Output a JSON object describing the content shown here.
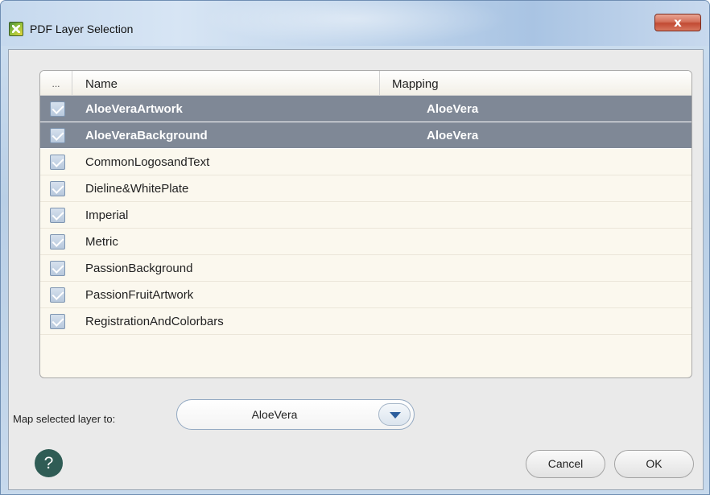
{
  "window": {
    "title": "PDF Layer Selection",
    "close_label": "x",
    "icon": "pdf-layer-app-icon"
  },
  "table": {
    "headers": {
      "select": "...",
      "name": "Name",
      "mapping": "Mapping"
    },
    "rows": [
      {
        "name": "AloeVeraArtwork",
        "mapping": "AloeVera",
        "checked": true,
        "selected": true
      },
      {
        "name": "AloeVeraBackground",
        "mapping": "AloeVera",
        "checked": true,
        "selected": true
      },
      {
        "name": "CommonLogosandText",
        "mapping": "",
        "checked": true,
        "selected": false
      },
      {
        "name": "Dieline&WhitePlate",
        "mapping": "",
        "checked": true,
        "selected": false
      },
      {
        "name": "Imperial",
        "mapping": "",
        "checked": true,
        "selected": false
      },
      {
        "name": "Metric",
        "mapping": "",
        "checked": true,
        "selected": false
      },
      {
        "name": "PassionBackground",
        "mapping": "",
        "checked": true,
        "selected": false
      },
      {
        "name": "PassionFruitArtwork",
        "mapping": "",
        "checked": true,
        "selected": false
      },
      {
        "name": "RegistrationAndColorbars",
        "mapping": "",
        "checked": true,
        "selected": false
      }
    ]
  },
  "map_selected": {
    "label": "Map selected layer to:",
    "value": "AloeVera"
  },
  "buttons": {
    "help": "?",
    "cancel": "Cancel",
    "ok": "OK"
  },
  "colors": {
    "selected_row": "#7f8896",
    "table_background": "#fbf8ee",
    "help_button": "#2f5c55",
    "close_button": "#c24a33"
  }
}
